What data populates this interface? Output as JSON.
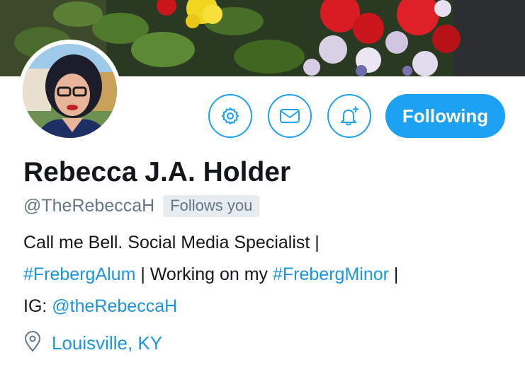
{
  "colors": {
    "accent": "#1da1f2",
    "link": "#1b95e0",
    "muted": "#657786",
    "badge_bg": "#e6ecf0"
  },
  "profile": {
    "display_name": "Rebecca J.A. Holder",
    "handle": "@TheRebeccaH",
    "follows_you": "Follows you",
    "bio": {
      "line1_text": "Call me Bell. Social Media Specialist |",
      "line2_tag1": "#FrebergAlum",
      "line2_mid": " | Working on my ",
      "line2_tag2": "#FrebergMinor",
      "line2_end": " |",
      "line3_prefix": "IG: ",
      "line3_mention": "@theRebeccaH"
    },
    "location": "Louisville, KY"
  },
  "actions": {
    "settings_icon": "gear-icon",
    "message_icon": "envelope-icon",
    "notify_icon": "bell-plus-icon",
    "following_label": "Following"
  }
}
